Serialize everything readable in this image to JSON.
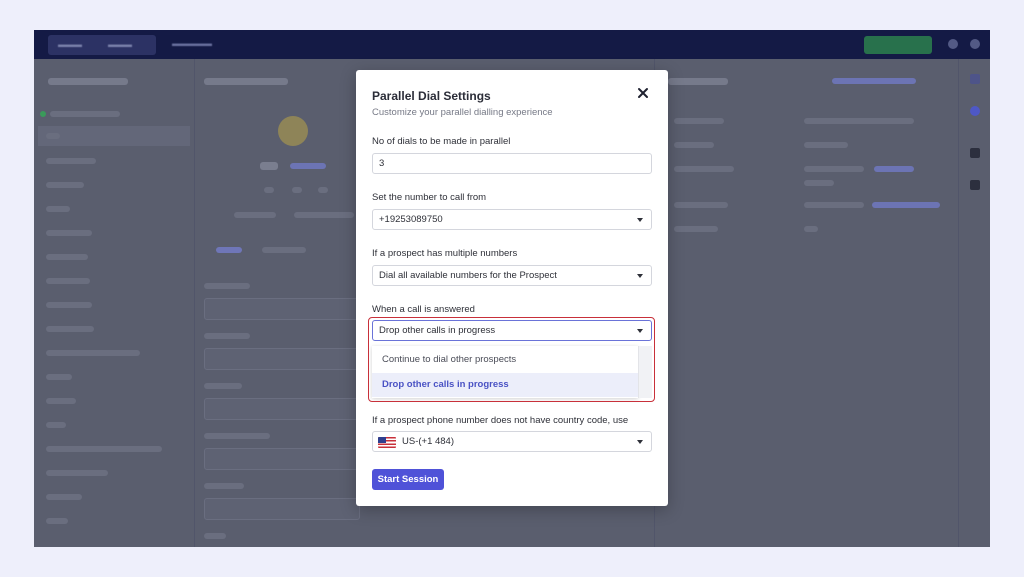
{
  "modal": {
    "title": "Parallel Dial Settings",
    "subtitle": "Customize your parallel dialling experience",
    "close_icon": "close-icon",
    "dials": {
      "label": "No of dials to be made in parallel",
      "value": "3"
    },
    "call_from": {
      "label": "Set the number to call from",
      "value": "+19253089750"
    },
    "multiple_numbers": {
      "label": "If a prospect has multiple numbers",
      "value": "Dial all available numbers for the Prospect"
    },
    "call_answered": {
      "label": "When a call is answered",
      "value": "Drop other calls in progress",
      "options": [
        "Continue to dial other prospects",
        "Drop other calls in progress"
      ],
      "selected_index": 1
    },
    "country_code": {
      "label": "If a prospect phone number does not have country code, use",
      "value": "US-(+1 484)",
      "flag_icon": "us-flag-icon"
    },
    "start_button": "Start Session"
  },
  "colors": {
    "accent": "#4f52d8",
    "highlight_border": "#c8303a",
    "topbar": "#141a45",
    "overlay": "#5a5e6e"
  }
}
